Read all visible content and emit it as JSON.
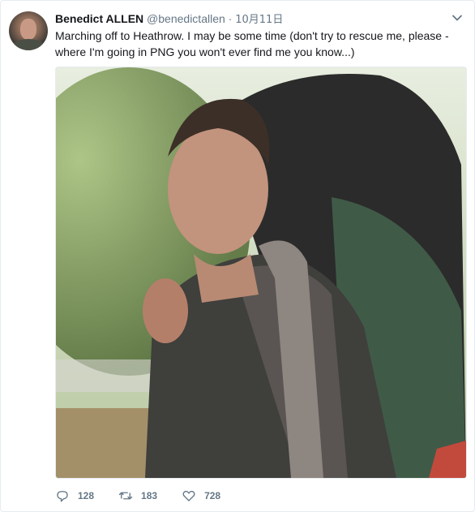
{
  "tweet": {
    "author_name": "Benedict ALLEN",
    "handle": "@benedictallen",
    "separator": "·",
    "date": "10月11日",
    "text": "Marching off to Heathrow. I may be some time (don't try to rescue me, please - where I'm going in PNG you won't ever find me you know...)",
    "replies": "128",
    "retweets": "183",
    "likes": "728"
  },
  "icons": {
    "menu": "chevron-down-icon",
    "reply": "reply-icon",
    "retweet": "retweet-icon",
    "like": "heart-icon"
  },
  "colors": {
    "secondary_text": "#657786",
    "border": "#e6ecf0"
  }
}
